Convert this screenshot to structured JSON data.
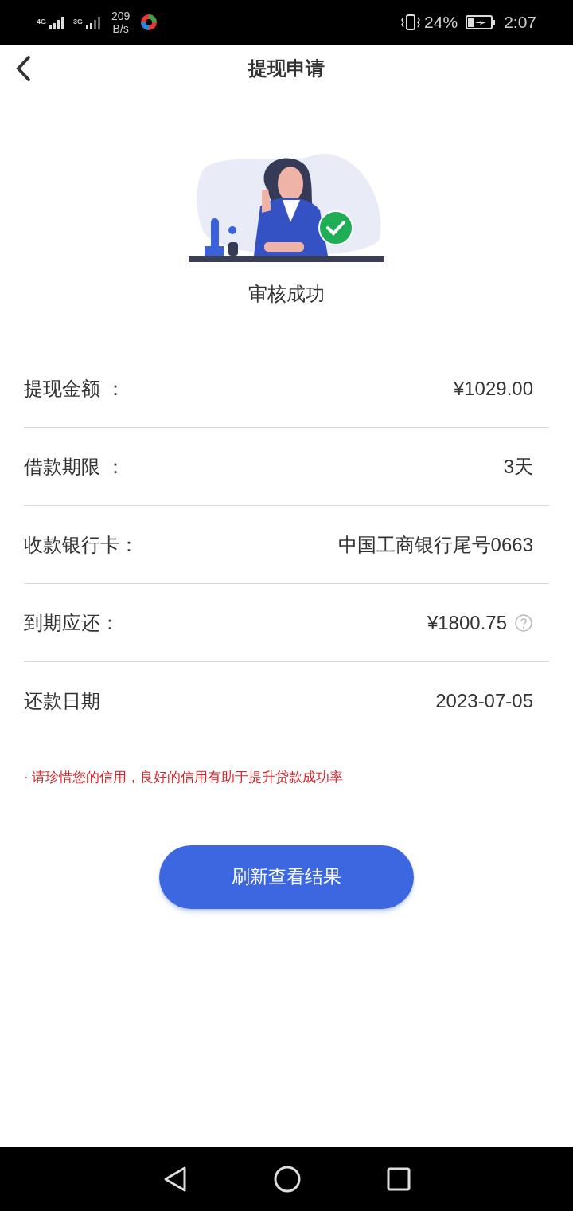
{
  "status_bar": {
    "network_1": "4G",
    "network_2": "3G",
    "speed_value": "209",
    "speed_unit": "B/s",
    "battery": "24%",
    "time": "2:07"
  },
  "header": {
    "title": "提现申请"
  },
  "result": {
    "text": "审核成功"
  },
  "rows": [
    {
      "label": "提现金额 ：",
      "value": "¥1029.00",
      "help": false
    },
    {
      "label": "借款期限 ：",
      "value": "3天",
      "help": false
    },
    {
      "label": "收款银行卡：",
      "value": "中国工商银行尾号0663",
      "help": false
    },
    {
      "label": "到期应还：",
      "value": "¥1800.75",
      "help": true
    },
    {
      "label": "还款日期",
      "value": "2023-07-05",
      "help": false
    }
  ],
  "note": "· 请珍惜您的信用，良好的信用有助于提升贷款成功率",
  "button": "刷新查看结果"
}
